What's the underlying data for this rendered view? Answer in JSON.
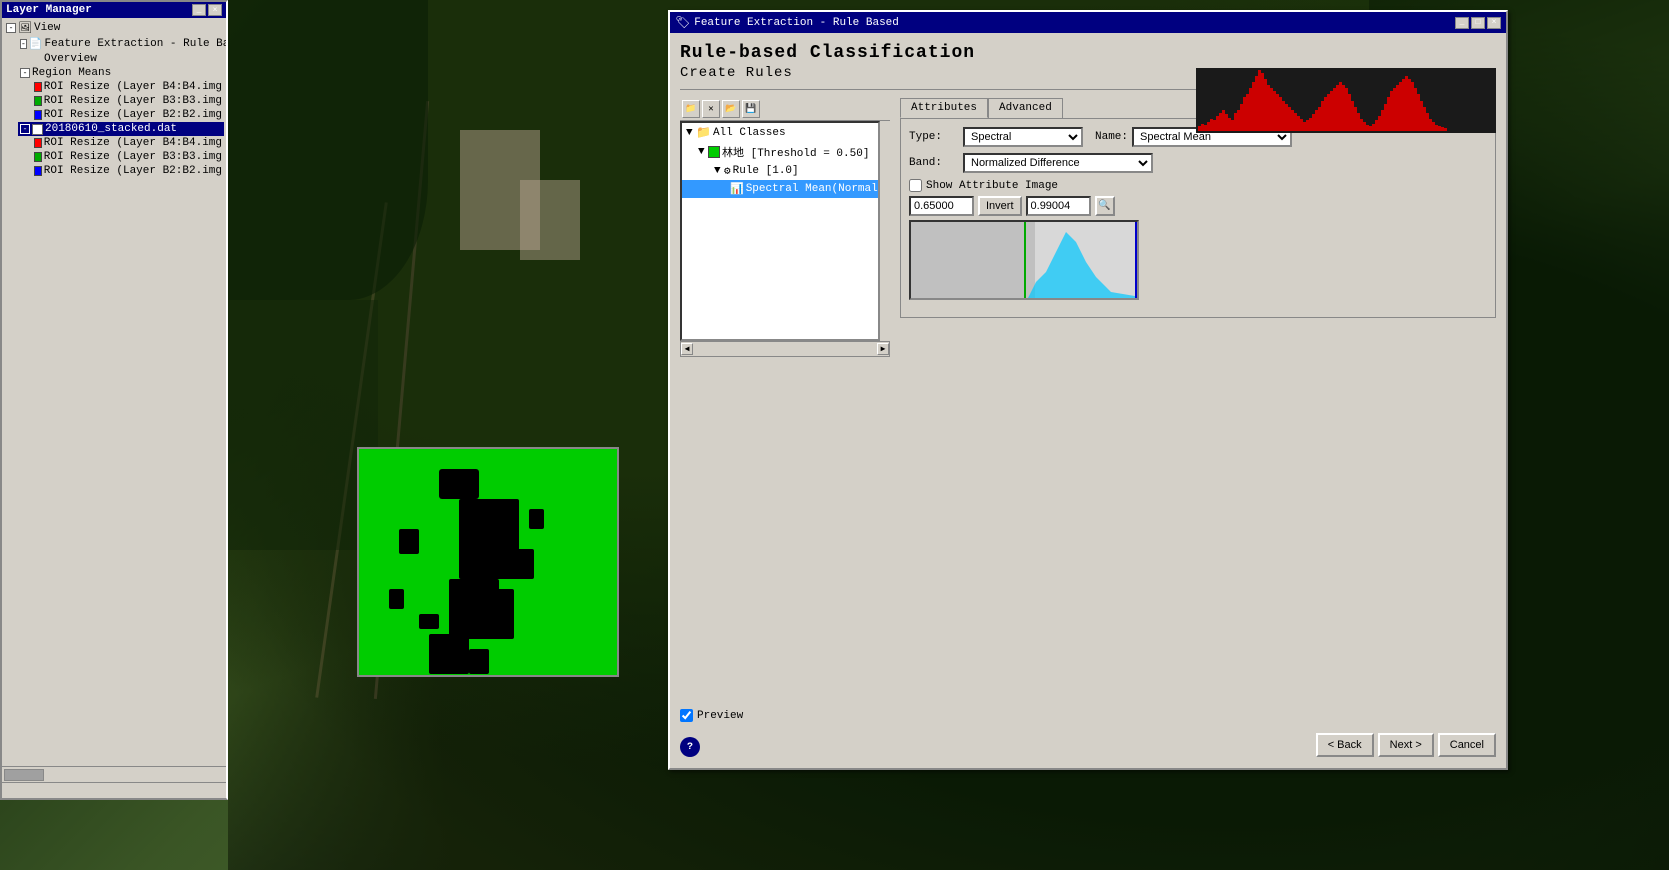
{
  "app": {
    "title": "Layer Manager",
    "feature_window_title": "Feature Extraction - Rule Based"
  },
  "layer_manager": {
    "title": "Layer Manager",
    "tree": [
      {
        "label": "View",
        "indent": 0,
        "icon": "folder",
        "expanded": true
      },
      {
        "label": "Feature Extraction - Rule Based",
        "indent": 1,
        "icon": "item",
        "expanded": true
      },
      {
        "label": "Overview",
        "indent": 2,
        "icon": "item"
      },
      {
        "label": "Region Means",
        "indent": 1,
        "icon": "folder",
        "expanded": true
      },
      {
        "label": "ROI Resize (Layer B4:B4.img",
        "indent": 2,
        "color": "#ff0000"
      },
      {
        "label": "ROI Resize (Layer B3:B3.img",
        "indent": 2,
        "color": "#00aa00"
      },
      {
        "label": "ROI Resize (Layer B2:B2.img",
        "indent": 2,
        "color": "#0000ff"
      },
      {
        "label": "20180610_stacked.dat",
        "indent": 1,
        "selected": true
      },
      {
        "label": "ROI Resize (Layer B4:B4.img",
        "indent": 2,
        "color": "#ff0000"
      },
      {
        "label": "ROI Resize (Layer B3:B3.img",
        "indent": 2,
        "color": "#00aa00"
      },
      {
        "label": "ROI Resize (Layer B2:B2.img",
        "indent": 2,
        "color": "#0000ff"
      }
    ],
    "scrollbar": true
  },
  "feature_extraction": {
    "title": "Feature Extraction - Rule Based",
    "main_title": "Rule-based Classification",
    "sub_title": "Create Rules",
    "toolbar_buttons": [
      "folder-open",
      "close",
      "open2",
      "save"
    ],
    "tree": {
      "nodes": [
        {
          "label": "All Classes",
          "indent": 0,
          "icon": "folder"
        },
        {
          "label": "林地 [Threshold = 0.50]",
          "indent": 1,
          "icon": "green-box"
        },
        {
          "label": "Rule [1.0]",
          "indent": 2,
          "icon": "rule"
        },
        {
          "label": "Spectral Mean(Normal...",
          "indent": 3,
          "selected": true
        }
      ]
    },
    "tabs": {
      "attributes": "Attributes",
      "advanced": "Advanced",
      "active": "attributes"
    },
    "form": {
      "type_label": "Type:",
      "type_value": "Spectral",
      "name_label": "Name:",
      "name_value": "Spectral Mean",
      "band_label": "Band:",
      "band_value": "Normalized Difference",
      "show_attr_image": "Show Attribute Image",
      "show_attr_checked": false,
      "min_value": "0.65000",
      "max_value": "0.99004",
      "invert_label": "Invert"
    },
    "histogram": {
      "bars": [
        5,
        8,
        12,
        15,
        20,
        18,
        25,
        30,
        35,
        40,
        45,
        50,
        55,
        60,
        58,
        55,
        52,
        48,
        45,
        42,
        40,
        38,
        35,
        30,
        28,
        25,
        22,
        20,
        18,
        15,
        12,
        10,
        8,
        6,
        5,
        4,
        3,
        2,
        2,
        3,
        4,
        5,
        6,
        8,
        10,
        12,
        15,
        18,
        20,
        25,
        30,
        35,
        40,
        45,
        50,
        55,
        60,
        62,
        60,
        55,
        50,
        45,
        40,
        35
      ]
    },
    "preview": {
      "label": "Preview",
      "checked": true
    },
    "buttons": {
      "back": "< Back",
      "next": "Next >",
      "cancel": "Cancel"
    }
  }
}
